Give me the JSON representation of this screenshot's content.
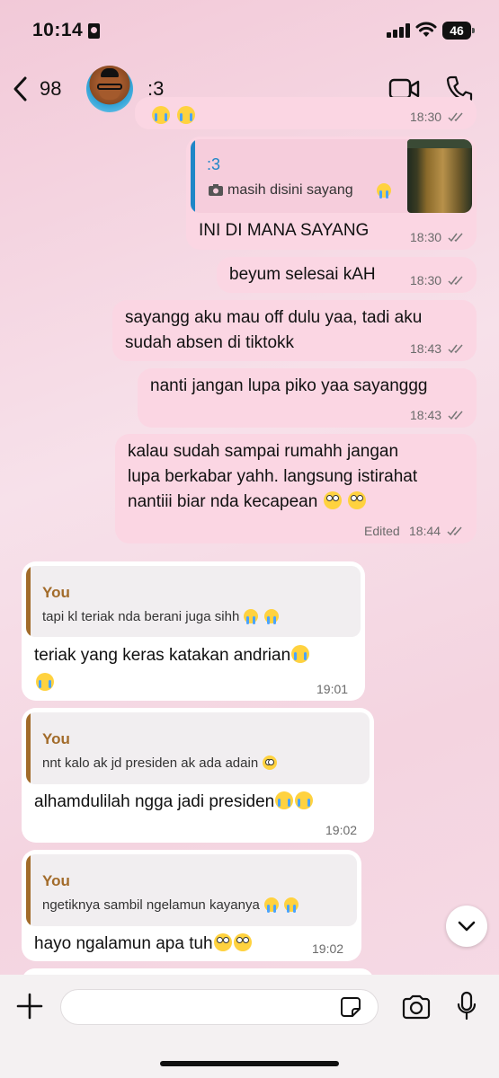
{
  "status_bar": {
    "time": "10:14",
    "battery": "46"
  },
  "header": {
    "back_count": "98",
    "contact_name": ":3"
  },
  "messages": {
    "m0": {
      "time": "18:30"
    },
    "m1": {
      "quote_author": ":3",
      "quote_text": "masih disini sayang",
      "text": "INI DI MANA SAYANG",
      "time": "18:30"
    },
    "m2": {
      "text": "beyum selesai kAH",
      "time": "18:30"
    },
    "m3": {
      "line1": "sayangg aku mau off dulu yaa, tadi aku",
      "line2": "sudah absen di tiktokk",
      "time": "18:43"
    },
    "m4": {
      "text": "nanti jangan lupa piko yaa sayanggg",
      "time": "18:43"
    },
    "m5": {
      "line1": "kalau sudah sampai rumahh jangan",
      "line2": "lupa berkabar yahh. langsung istirahat",
      "line3": "nantiii biar nda kecapean",
      "edited": "Edited",
      "time": "18:44"
    },
    "m6": {
      "quote_author": "You",
      "quote_text": "tapi kl teriak nda berani juga sihh",
      "text": "teriak yang keras katakan andrian",
      "time": "19:01"
    },
    "m7": {
      "quote_author": "You",
      "quote_text": "nnt kalo ak jd presiden ak ada adain",
      "text": "alhamdulilah ngga jadi presiden",
      "time": "19:02"
    },
    "m8": {
      "quote_author": "You",
      "quote_text": "ngetiknya sambil ngelamun kayanya",
      "text": "hayo ngalamun apa tuh",
      "time": "19:02"
    }
  },
  "composer": {
    "placeholder": ""
  },
  "icons": {
    "back": "chevron-left-icon",
    "video": "video-call-icon",
    "phone": "phone-icon",
    "plus": "plus-icon",
    "sticker": "sticker-icon",
    "camera": "camera-icon",
    "mic": "microphone-icon",
    "scroll": "chevron-down-icon"
  },
  "colors": {
    "outgoing_bubble": "#fbd6e3",
    "incoming_bubble": "#ffffff",
    "quote_accent_own": "#a26b2a",
    "quote_accent_contact": "#1f86c7",
    "tick": "#777777"
  }
}
